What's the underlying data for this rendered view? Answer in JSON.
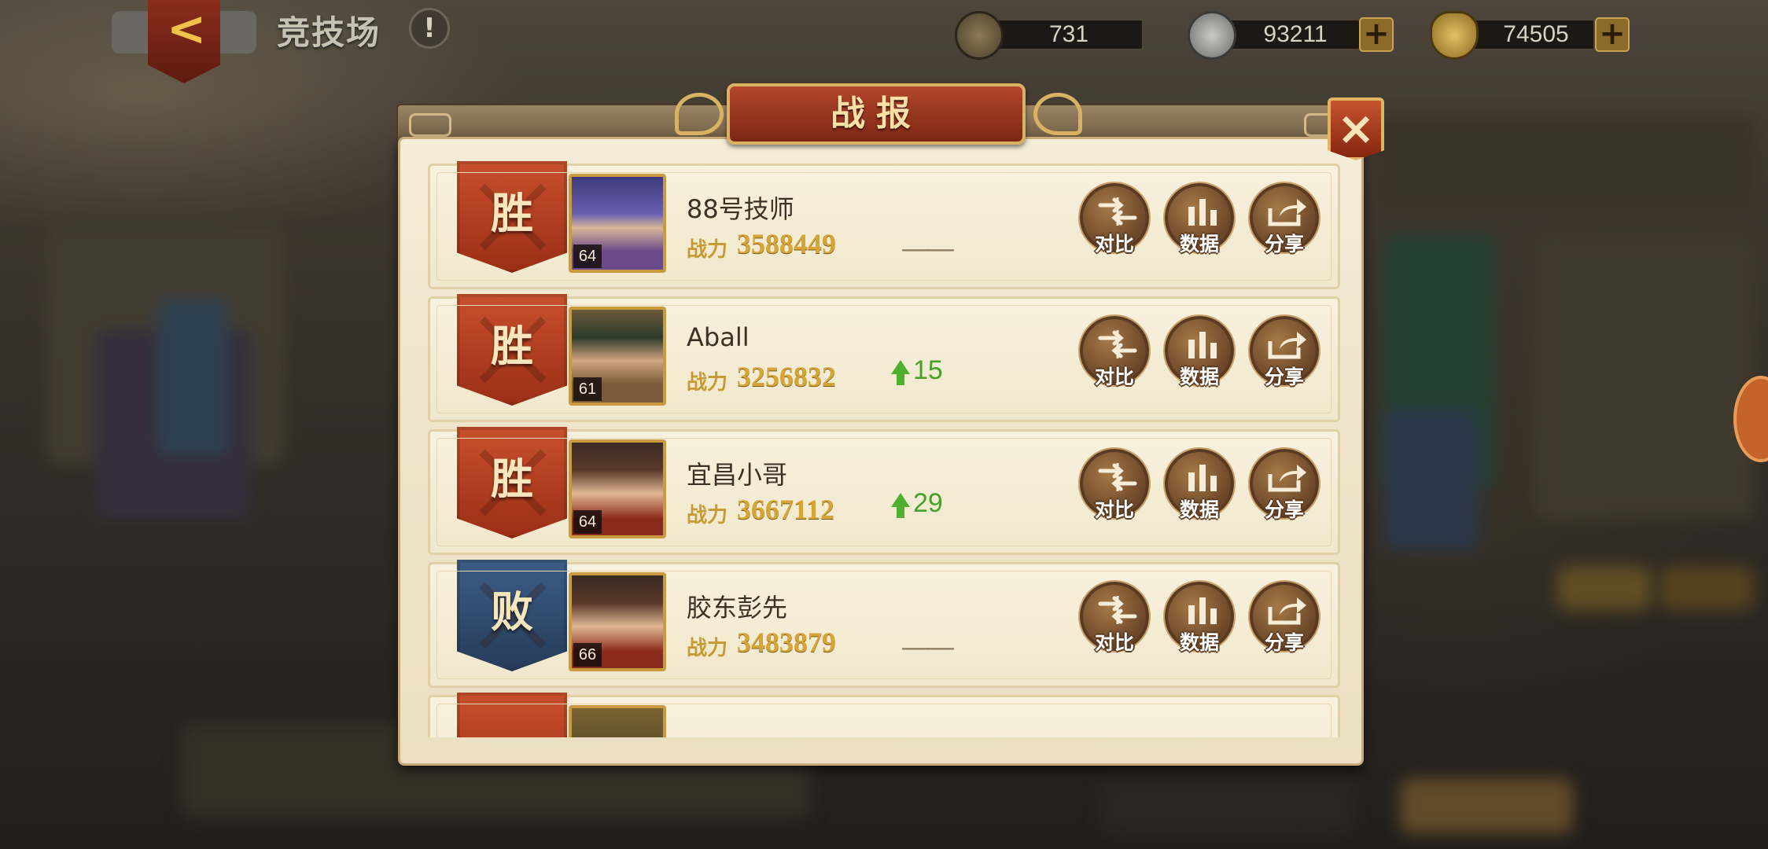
{
  "header": {
    "title": "竞技场",
    "info_icon": "!",
    "currencies": [
      {
        "icon": "copper-coin-icon",
        "value": "731",
        "has_plus": false
      },
      {
        "icon": "silver-coin-icon",
        "value": "93211",
        "has_plus": true
      },
      {
        "icon": "gold-ingot-icon",
        "value": "74505",
        "has_plus": true
      }
    ],
    "plus_label": "+"
  },
  "modal": {
    "title": "战报",
    "close_label": "×",
    "power_label": "战力",
    "action_labels": {
      "compare": "对比",
      "data": "数据",
      "share": "分享"
    },
    "records": [
      {
        "result": "胜",
        "outcome": "win",
        "player": "88号技师",
        "level": "64",
        "power": "3588449",
        "rank_change": "——",
        "rank_up": false
      },
      {
        "result": "胜",
        "outcome": "win",
        "player": "Aball",
        "level": "61",
        "power": "3256832",
        "rank_change": "15",
        "rank_up": true
      },
      {
        "result": "胜",
        "outcome": "win",
        "player": "宜昌小哥",
        "level": "64",
        "power": "3667112",
        "rank_change": "29",
        "rank_up": true
      },
      {
        "result": "败",
        "outcome": "lose",
        "player": "胶东彭先",
        "level": "66",
        "power": "3483879",
        "rank_change": "——",
        "rank_up": false
      }
    ]
  },
  "colors": {
    "win": "#b8411f",
    "lose": "#314d73",
    "rank_up": "#46a12a",
    "power": "#d6a537"
  }
}
